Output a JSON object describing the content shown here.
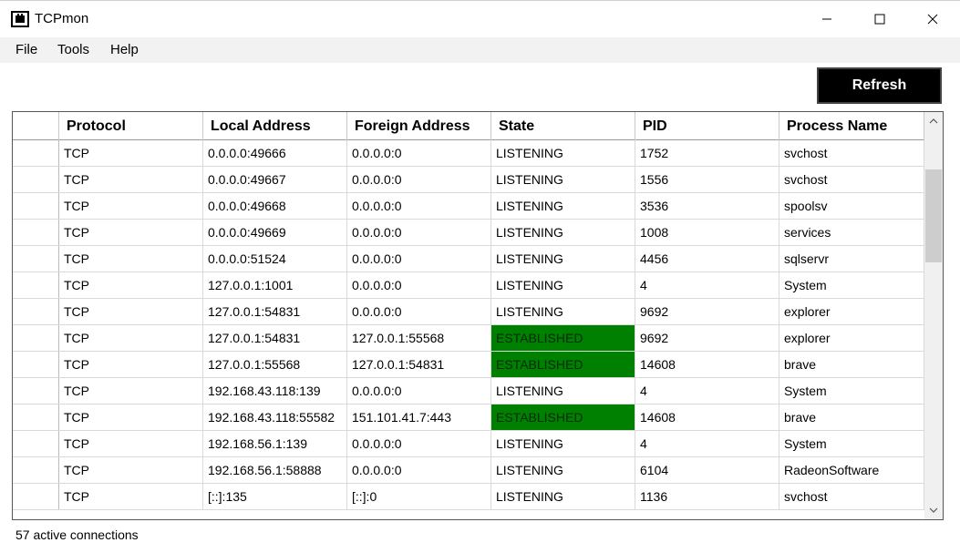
{
  "window": {
    "title": "TCPmon",
    "minimize": "—",
    "maximize": "☐",
    "close": "✕"
  },
  "menu": {
    "items": [
      "File",
      "Tools",
      "Help"
    ]
  },
  "toolbar": {
    "refresh_label": "Refresh"
  },
  "table": {
    "columns": [
      "Protocol",
      "Local Address",
      "Foreign Address",
      "State",
      "PID",
      "Process Name"
    ],
    "rows": [
      [
        "TCP",
        "0.0.0.0:49666",
        "0.0.0.0:0",
        "LISTENING",
        "1752",
        "svchost"
      ],
      [
        "TCP",
        "0.0.0.0:49667",
        "0.0.0.0:0",
        "LISTENING",
        "1556",
        "svchost"
      ],
      [
        "TCP",
        "0.0.0.0:49668",
        "0.0.0.0:0",
        "LISTENING",
        "3536",
        "spoolsv"
      ],
      [
        "TCP",
        "0.0.0.0:49669",
        "0.0.0.0:0",
        "LISTENING",
        "1008",
        "services"
      ],
      [
        "TCP",
        "0.0.0.0:51524",
        "0.0.0.0:0",
        "LISTENING",
        "4456",
        "sqlservr"
      ],
      [
        "TCP",
        "127.0.0.1:1001",
        "0.0.0.0:0",
        "LISTENING",
        "4",
        "System"
      ],
      [
        "TCP",
        "127.0.0.1:54831",
        "0.0.0.0:0",
        "LISTENING",
        "9692",
        "explorer"
      ],
      [
        "TCP",
        "127.0.0.1:54831",
        "127.0.0.1:55568",
        "ESTABLISHED",
        "9692",
        "explorer"
      ],
      [
        "TCP",
        "127.0.0.1:55568",
        "127.0.0.1:54831",
        "ESTABLISHED",
        "14608",
        "brave"
      ],
      [
        "TCP",
        "192.168.43.118:139",
        "0.0.0.0:0",
        "LISTENING",
        "4",
        "System"
      ],
      [
        "TCP",
        "192.168.43.118:55582",
        "151.101.41.7:443",
        "ESTABLISHED",
        "14608",
        "brave"
      ],
      [
        "TCP",
        "192.168.56.1:139",
        "0.0.0.0:0",
        "LISTENING",
        "4",
        "System"
      ],
      [
        "TCP",
        "192.168.56.1:58888",
        "0.0.0.0:0",
        "LISTENING",
        "6104",
        "RadeonSoftware"
      ],
      [
        "TCP",
        "[::]:135",
        "[::]:0",
        "LISTENING",
        "1136",
        "svchost"
      ]
    ],
    "established_color": "#008000"
  },
  "status": {
    "text": "57 active connections"
  },
  "icons": {
    "app": "network-port-icon",
    "scroll_up": "chevron-up-icon",
    "scroll_down": "chevron-down-icon"
  }
}
